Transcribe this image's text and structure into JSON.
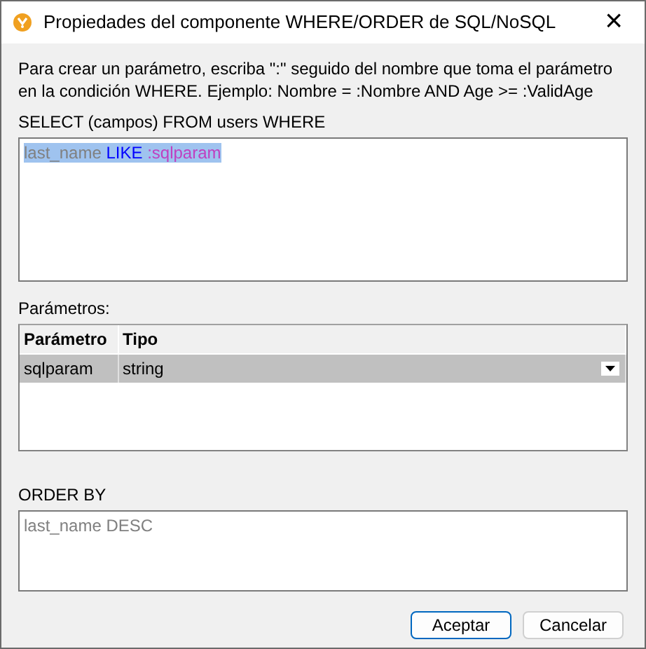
{
  "window": {
    "title": "Propiedades del componente WHERE/ORDER de SQL/NoSQL",
    "close": "×"
  },
  "description": "Para crear un parámetro, escriba \":\" seguido del nombre que toma el parámetro en la condición WHERE. Ejemplo: Nombre = :Nombre AND Age >= :ValidAge",
  "where": {
    "label": "SELECT (campos) FROM users WHERE",
    "selected": true,
    "tokens": [
      {
        "kind": "identifier",
        "text": "last_name"
      },
      {
        "kind": "keyword",
        "text": "LIKE"
      },
      {
        "kind": "parameter",
        "text": ":sqlparam"
      }
    ]
  },
  "parameters": {
    "label": "Parámetros:",
    "columns": [
      "Parámetro",
      "Tipo"
    ],
    "rows": [
      {
        "name": "sqlparam",
        "type": "string",
        "selected": true
      }
    ]
  },
  "order_by": {
    "label": "ORDER BY",
    "value": "last_name DESC"
  },
  "buttons": [
    {
      "label": "Aceptar",
      "default": true
    },
    {
      "label": "Cancelar",
      "default": false
    }
  ]
}
